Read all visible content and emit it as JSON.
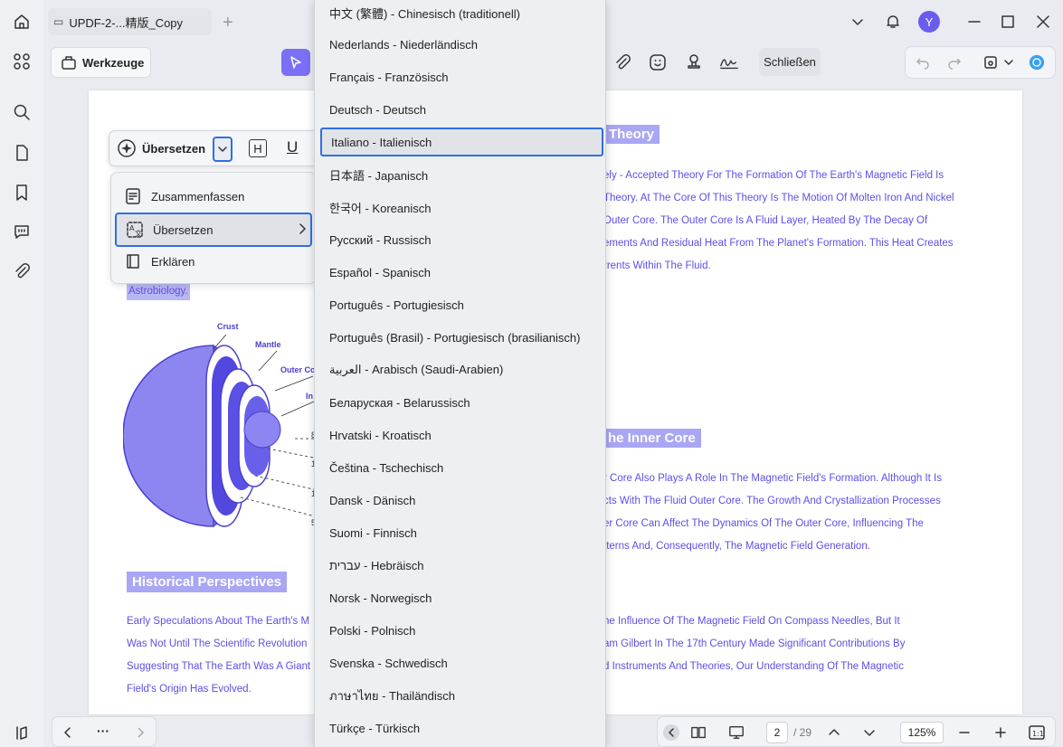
{
  "window": {
    "tab_title": "UPDF-2-...精版_Copy",
    "avatar_letter": "Y"
  },
  "toolbar": {
    "tools_label": "Werkzeuge",
    "close_label": "Schließen"
  },
  "document": {
    "heading_theory": "Theory",
    "heading_inner_core": "he Inner Core",
    "heading_historical": "Historical Perspectives",
    "theory_lines": [
      "ely - Accepted Theory For The Formation Of The Earth's Magnetic Field Is",
      "Theory. At The Core Of This Theory Is The Motion Of Molten Iron And Nickel",
      "Outer Core. The Outer Core Is A Fluid Layer, Heated By The Decay Of",
      "ements And Residual Heat From The Planet's Formation. This Heat Creates",
      "rrents Within The Fluid."
    ],
    "highlight_text": "Astrobiology.",
    "inner_core_lines": [
      "r Core Also Plays A Role In The Magnetic Field's Formation. Although It Is",
      "cts With The Fluid Outer Core. The Growth And Crystallization Processes",
      "er Core Can Affect The Dynamics Of The Outer Core, Influencing The",
      "tterns And, Consequently, The Magnetic Field Generation."
    ],
    "historical_left_lines": [
      "Early Speculations About The Earth's M",
      "Was Not Until The Scientific Revolution",
      "Suggesting That The Earth Was A Giant",
      "Field's Origin Has Evolved."
    ],
    "historical_right_lines": [
      "he Influence Of The Magnetic Field On Compass Needles, But It",
      "am Gilbert In The 17th Century Made Significant Contributions By",
      "d Instruments And Theories, Our Understanding Of The Magnetic"
    ],
    "diagram_labels": {
      "crust": "Crust",
      "mantle": "Mantle",
      "outer_core": "Outer Co",
      "inner": "In",
      "marks": [
        "8",
        "1",
        "1",
        "5"
      ]
    }
  },
  "translate_toolbar": {
    "label": "Übersetzen",
    "h_label": "H",
    "u_label": "U"
  },
  "ai_menu": {
    "items": [
      "Zusammenfassen",
      "Übersetzen",
      "Erklären"
    ]
  },
  "languages": {
    "items": [
      "中文 (繁體) - Chinesisch (traditionell)",
      "Nederlands - Niederländisch",
      "Français - Französisch",
      "Deutsch - Deutsch",
      "Italiano - Italienisch",
      "日本語 - Japanisch",
      "한국어 - Koreanisch",
      "Русский - Russisch",
      "Español - Spanisch",
      "Português - Portugiesisch",
      "Português (Brasil) - Portugiesisch (brasilianisch)",
      "العربية - Arabisch (Saudi-Arabien)",
      "Беларуская - Belarussisch",
      "Hrvatski - Kroatisch",
      "Čeština - Tschechisch",
      "Dansk - Dänisch",
      "Suomi - Finnisch",
      "עברית - Hebräisch",
      "Norsk - Norwegisch",
      "Polski - Polnisch",
      "Svenska - Schwedisch",
      "ภาษาไทย - Thailändisch",
      "Türkçe - Türkisch"
    ],
    "selected_index": 4
  },
  "bottom": {
    "more_label": "···",
    "page_current": "2",
    "page_total": "/ 29",
    "zoom": "125%"
  },
  "colors": {
    "accent": "#2f6fe4",
    "heading_bg": "#a9a6f4",
    "text_blue": "#5b50e8",
    "pointer_bg": "#7b6ff5"
  }
}
